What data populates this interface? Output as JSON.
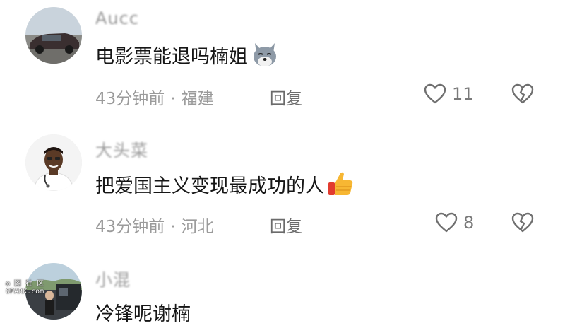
{
  "comments": [
    {
      "username": "Aucc",
      "content": "电影票能退吗楠姐",
      "emoji": "wolf-face-emoji",
      "time": "43分钟前",
      "location": "福建",
      "reply_label": "回复",
      "likes": "11"
    },
    {
      "username": "大头菜",
      "content": "把爱国主义变现最成功的人",
      "emoji": "thumbs-up-emoji",
      "time": "43分钟前",
      "location": "河北",
      "reply_label": "回复",
      "likes": "8"
    },
    {
      "username": "小混",
      "content": "冷锋呢谢楠"
    }
  ],
  "meta_separator": "·",
  "watermark": {
    "line1": "◎ 图 社 区",
    "line2": "6PARK.com"
  },
  "colors": {
    "text_primary": "#161616",
    "text_secondary": "#9b9b9b",
    "reply": "#6b6b6b",
    "icon_stroke": "#6f6f6f"
  }
}
